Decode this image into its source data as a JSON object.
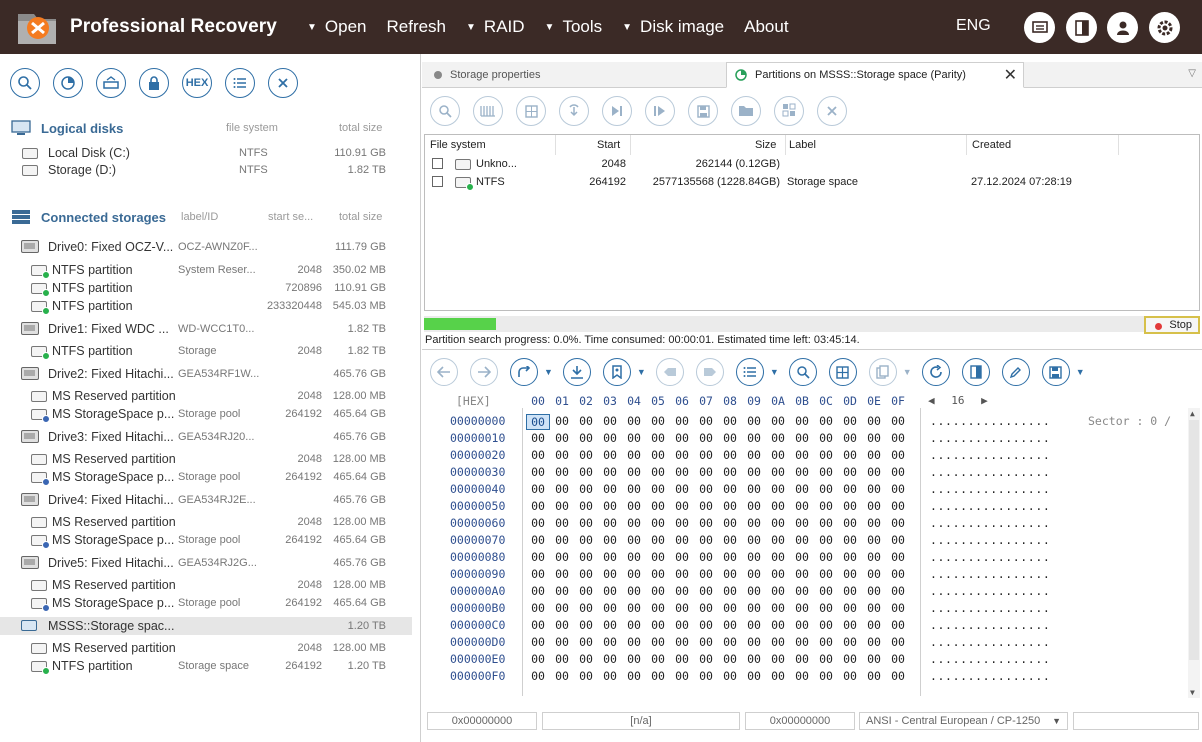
{
  "app": {
    "title": "Professional Recovery",
    "menu": [
      {
        "label": "Open",
        "caret": true
      },
      {
        "label": "Refresh",
        "caret": false
      },
      {
        "label": "RAID",
        "caret": true
      },
      {
        "label": "Tools",
        "caret": true
      },
      {
        "label": "Disk image",
        "caret": true
      },
      {
        "label": "About",
        "caret": false
      }
    ],
    "language": "ENG",
    "top_icons": [
      "monitor-icon",
      "panel-icon",
      "user-icon",
      "gear-icon"
    ]
  },
  "left": {
    "toolbar": [
      "search-icon",
      "chart-icon",
      "drive-open-icon",
      "lock-icon",
      "HEX",
      "list-icon",
      "close-icon"
    ],
    "logical": {
      "title": "Logical disks",
      "col_fs": "file system",
      "col_size": "total size",
      "items": [
        {
          "name": "Local Disk (C:)",
          "fs": "NTFS",
          "size": "110.91 GB"
        },
        {
          "name": "Storage (D:)",
          "fs": "NTFS",
          "size": "1.82 TB"
        }
      ]
    },
    "storages": {
      "title": "Connected storages",
      "col_label": "label/ID",
      "col_start": "start se...",
      "col_size": "total size",
      "rows": [
        {
          "type": "drive",
          "name": "Drive0: Fixed OCZ-V...",
          "label": "OCZ-AWNZ0F...",
          "start": "",
          "size": "111.79 GB"
        },
        {
          "type": "part",
          "status": "green",
          "name": "NTFS partition",
          "label": "System Reser...",
          "start": "2048",
          "size": "350.02 MB"
        },
        {
          "type": "part",
          "status": "green",
          "name": "NTFS partition",
          "label": "",
          "start": "720896",
          "size": "110.91 GB"
        },
        {
          "type": "part",
          "status": "green",
          "name": "NTFS partition",
          "label": "",
          "start": "233320448",
          "size": "545.03 MB"
        },
        {
          "type": "drive",
          "name": "Drive1: Fixed WDC ...",
          "label": "WD-WCC1T0...",
          "start": "",
          "size": "1.82 TB"
        },
        {
          "type": "part",
          "status": "green",
          "name": "NTFS partition",
          "label": "Storage",
          "start": "2048",
          "size": "1.82 TB"
        },
        {
          "type": "drive",
          "name": "Drive2: Fixed Hitachi...",
          "label": "GEA534RF1W...",
          "start": "",
          "size": "465.76 GB"
        },
        {
          "type": "part",
          "status": "none",
          "name": "MS Reserved partition",
          "label": "",
          "start": "2048",
          "size": "128.00 MB"
        },
        {
          "type": "part",
          "status": "blue",
          "name": "MS StorageSpace p...",
          "label": "Storage pool",
          "start": "264192",
          "size": "465.64 GB"
        },
        {
          "type": "drive",
          "name": "Drive3: Fixed Hitachi...",
          "label": "GEA534RJ20...",
          "start": "",
          "size": "465.76 GB"
        },
        {
          "type": "part",
          "status": "none",
          "name": "MS Reserved partition",
          "label": "",
          "start": "2048",
          "size": "128.00 MB"
        },
        {
          "type": "part",
          "status": "blue",
          "name": "MS StorageSpace p...",
          "label": "Storage pool",
          "start": "264192",
          "size": "465.64 GB"
        },
        {
          "type": "drive",
          "name": "Drive4: Fixed Hitachi...",
          "label": "GEA534RJ2E...",
          "start": "",
          "size": "465.76 GB"
        },
        {
          "type": "part",
          "status": "none",
          "name": "MS Reserved partition",
          "label": "",
          "start": "2048",
          "size": "128.00 MB"
        },
        {
          "type": "part",
          "status": "blue",
          "name": "MS StorageSpace p...",
          "label": "Storage pool",
          "start": "264192",
          "size": "465.64 GB"
        },
        {
          "type": "drive",
          "name": "Drive5: Fixed Hitachi...",
          "label": "GEA534RJ2G...",
          "start": "",
          "size": "465.76 GB"
        },
        {
          "type": "part",
          "status": "none",
          "name": "MS Reserved partition",
          "label": "",
          "start": "2048",
          "size": "128.00 MB"
        },
        {
          "type": "part",
          "status": "blue",
          "name": "MS StorageSpace p...",
          "label": "Storage pool",
          "start": "264192",
          "size": "465.64 GB"
        },
        {
          "type": "space",
          "name": "MSSS::Storage spac...",
          "label": "",
          "start": "",
          "size": "1.20 TB",
          "selected": true
        },
        {
          "type": "part",
          "status": "none",
          "name": "MS Reserved partition",
          "label": "",
          "start": "2048",
          "size": "128.00 MB"
        },
        {
          "type": "part",
          "status": "green",
          "name": "NTFS partition",
          "label": "Storage space",
          "start": "264192",
          "size": "1.20 TB"
        }
      ]
    }
  },
  "right": {
    "tabs": [
      {
        "label": "Storage properties",
        "active": false
      },
      {
        "label": "Partitions on MSSS::Storage space (Parity)",
        "active": true
      }
    ],
    "toolbar": [
      "search-icon",
      "scan-icon",
      "grid-icon",
      "restore-icon",
      "skip-icon",
      "play-icon",
      "save-icon",
      "folder-icon",
      "report-icon",
      "close-icon"
    ],
    "partitions": {
      "columns": {
        "fs": "File system",
        "start": "Start",
        "size": "Size",
        "label": "Label",
        "created": "Created"
      },
      "rows": [
        {
          "fs": "Unkno...",
          "status": "none",
          "start": "2048",
          "size": "262144 (0.12GB)",
          "label": "",
          "created": ""
        },
        {
          "fs": "NTFS",
          "status": "green",
          "start": "264192",
          "size": "2577135568 (1228.84GB)",
          "label": "Storage space",
          "created": "27.12.2024 07:28:19"
        }
      ]
    },
    "progress": {
      "fraction": 0.1,
      "text": "Partition search progress: 0.0%. Time consumed: 00:00:01. Estimated time left: 03:45:14.",
      "stop_label": "Stop"
    },
    "hex": {
      "label": "[HEX]",
      "columns": [
        "00",
        "01",
        "02",
        "03",
        "04",
        "05",
        "06",
        "07",
        "08",
        "09",
        "0A",
        "0B",
        "0C",
        "0D",
        "0E",
        "0F"
      ],
      "nav_value": "16",
      "sector": "Sector : 0 /",
      "addresses": [
        "00000000",
        "00000010",
        "00000020",
        "00000030",
        "00000040",
        "00000050",
        "00000060",
        "00000070",
        "00000080",
        "00000090",
        "000000A0",
        "000000B0",
        "000000C0",
        "000000D0",
        "000000E0",
        "000000F0"
      ],
      "byte_value": "00",
      "ascii_row": "................"
    },
    "status": {
      "offset": "0x00000000",
      "na": "[n/a]",
      "offset2": "0x00000000",
      "encoding": "ANSI - Central European / CP-1250"
    }
  }
}
